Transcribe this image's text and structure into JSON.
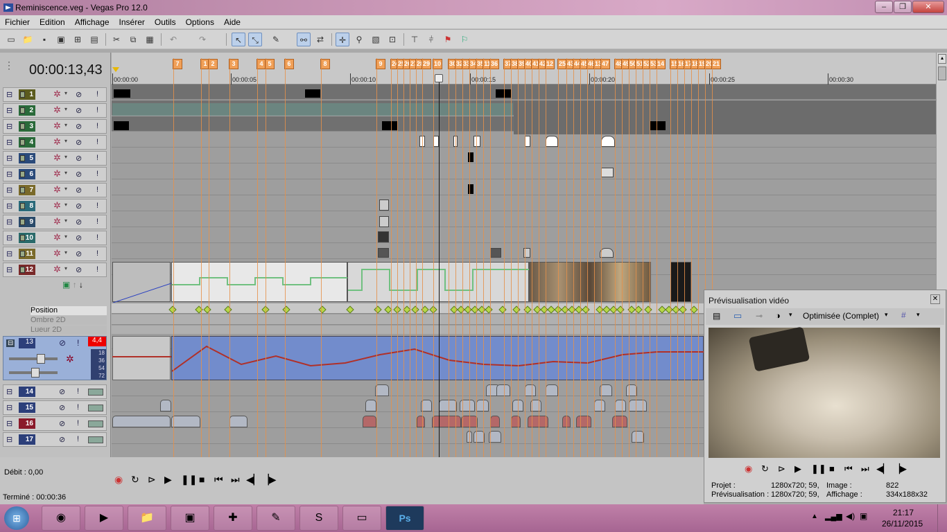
{
  "window": {
    "title": "Reminiscence.veg - Vegas Pro 12.0",
    "minimize": "–",
    "maximize": "❐",
    "close": "✕"
  },
  "menu": [
    "Fichier",
    "Edition",
    "Affichage",
    "Insérer",
    "Outils",
    "Options",
    "Aide"
  ],
  "timecode": "00:00:13,43",
  "ruler": {
    "ticks": [
      "00:00:00",
      "00:00:05",
      "00:00:10",
      "00:00:15",
      "00:00:20",
      "00:00:25",
      "00:00:30"
    ],
    "markers": [
      "7",
      "1",
      "2",
      "3",
      "4",
      "5",
      "6",
      "8",
      "9",
      "24",
      "25",
      "26",
      "27",
      "28",
      "29",
      "10",
      "30",
      "32",
      "33",
      "34",
      "35",
      "11",
      "36",
      "37",
      "38",
      "39",
      "40",
      "41",
      "42",
      "12",
      "25",
      "43",
      "44",
      "45",
      "46",
      "13",
      "47",
      "48",
      "49",
      "50",
      "51",
      "52",
      "53",
      "14",
      "15",
      "16",
      "17",
      "18",
      "19",
      "20",
      "21"
    ]
  },
  "tracks": {
    "video": [
      "1",
      "2",
      "3",
      "4",
      "5",
      "6",
      "7",
      "8",
      "9",
      "10",
      "11",
      "12"
    ],
    "audio": [
      "13",
      "14",
      "15",
      "16",
      "17"
    ]
  },
  "envelopes": [
    "Position",
    "Ombre 2D",
    "Lueur 2D"
  ],
  "audio_level": "4,4",
  "audio_db": [
    "18",
    "36",
    "54",
    "72"
  ],
  "status": {
    "debit": "Débit : 0,00",
    "termine": "Terminé : 00:00:36"
  },
  "preview": {
    "title": "Prévisualisation vidéo",
    "quality": "Optimisée (Complet)",
    "projet_label": "Projet :",
    "projet_value": "1280x720; 59,",
    "previs_label": "Prévisualisation :",
    "previs_value": "1280x720; 59,",
    "image_label": "Image :",
    "image_value": "822",
    "affichage_label": "Affichage :",
    "affichage_value": "334x188x32"
  },
  "taskbar": {
    "time": "21:17",
    "date": "26/11/2015"
  },
  "colors": {
    "marker": "#f0a058",
    "audio_wave": "#5a78c0",
    "envelope": "#b03028",
    "titlebar": "#c997b6"
  }
}
